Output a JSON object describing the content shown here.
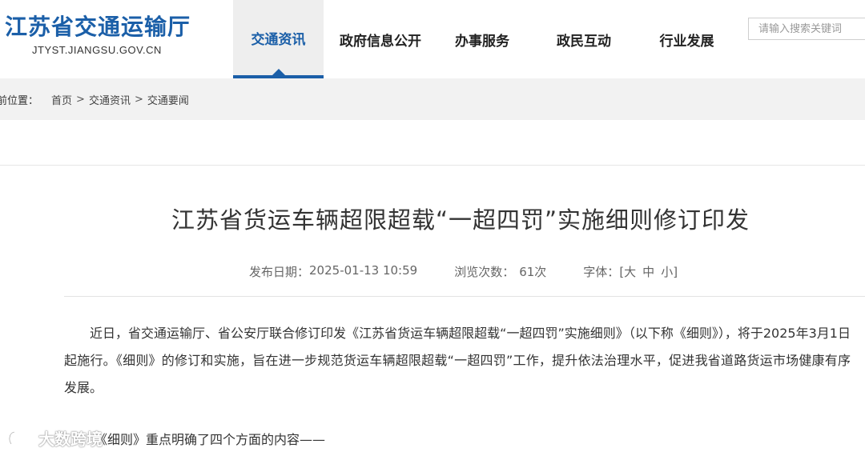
{
  "site": {
    "title": "江苏省交通运输厅",
    "domain": "JTYST.JIANGSU.GOV.CN"
  },
  "nav": [
    {
      "label": "交通资讯",
      "active": true
    },
    {
      "label": "政府信息公开",
      "active": false
    },
    {
      "label": "办事服务",
      "active": false
    },
    {
      "label": "政民互动",
      "active": false
    },
    {
      "label": "行业发展",
      "active": false
    }
  ],
  "search": {
    "placeholder": "请输入搜索关键词"
  },
  "breadcrumb": {
    "label": "前位置：",
    "items": [
      "首页",
      "交通资讯",
      "交通要闻"
    ],
    "separator": ">"
  },
  "article": {
    "title": "江苏省货运车辆超限超载“一超四罚”实施细则修订印发",
    "publish_label": "发布日期：",
    "publish_date": "2025-01-13 10:59",
    "views_label": "浏览次数：",
    "views": "61次",
    "font_label": "字体：",
    "font_sizes": [
      "[大",
      "中",
      "小]"
    ],
    "paragraph1": "近日，省交通运输厅、省公安厅联合修订印发《江苏省货运车辆超限超载“一超四罚”实施细则》（以下称《细则》），将于2025年3月1日起施行。《细则》的修订和实施，旨在进一步规范货运车辆超限超载“一超四罚”工作，提升依法治理水平，促进我省道路货运市场健康有序发展。",
    "paragraph2": "《细则》重点明确了四个方面的内容——"
  },
  "watermark": {
    "text": "大数跨境"
  },
  "colors": {
    "brand": "#1b5fa8",
    "breadcrumb_bg": "#f2f2f2",
    "active_tab_bg": "#eeeeee"
  }
}
